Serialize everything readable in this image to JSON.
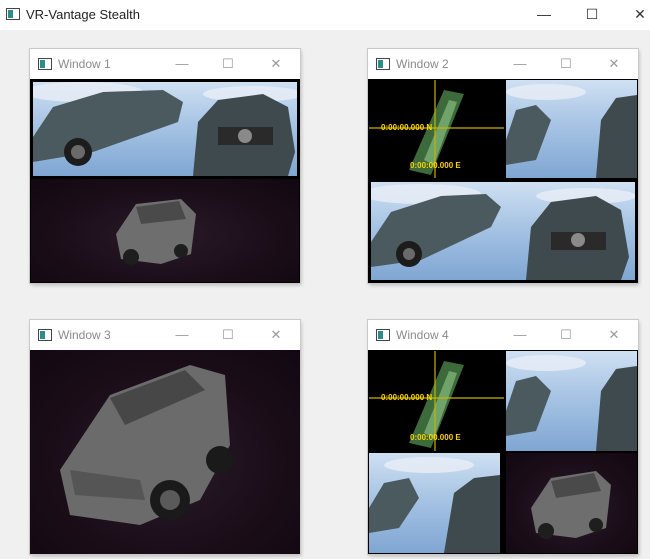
{
  "app": {
    "title": "VR-Vantage Stealth",
    "controls": {
      "minimize": "—",
      "maximize": "☐",
      "close": "✕"
    }
  },
  "windows": [
    {
      "title": "Window 1"
    },
    {
      "title": "Window 2",
      "map": {
        "north": "0:00:00.000 N",
        "east": "0:00:00.000 E"
      }
    },
    {
      "title": "Window 3"
    },
    {
      "title": "Window 4",
      "map": {
        "north": "0:00:00.000 N",
        "east": "0:00:00.000 E"
      }
    }
  ],
  "sub_controls": {
    "minimize": "—",
    "maximize": "☐",
    "close": "✕"
  },
  "colors": {
    "coord_text": "#ffd400",
    "crosshair": "#c8b400",
    "sky": "#a7c4e4",
    "dark_scene": "#1a0d18"
  }
}
